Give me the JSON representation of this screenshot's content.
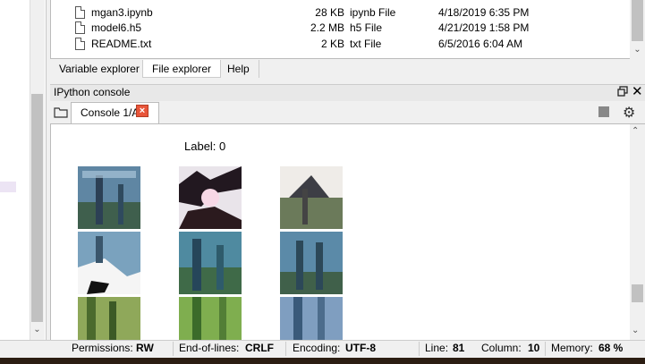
{
  "files": [
    {
      "name": "mgan3.ipynb",
      "size": "28 KB",
      "type": "ipynb File",
      "date": "4/18/2019 6:35 PM"
    },
    {
      "name": "model6.h5",
      "size": "2.2 MB",
      "type": "h5 File",
      "date": "4/21/2019 1:58 PM"
    },
    {
      "name": "README.txt",
      "size": "2 KB",
      "type": "txt File",
      "date": "6/5/2016 6:04 AM"
    }
  ],
  "bottom_tabs": [
    "Variable explorer",
    "File explorer",
    "Help"
  ],
  "console": {
    "pane_title": "IPython console",
    "tab_label": "Console 1/A",
    "tab_close": "×",
    "output_label": "Label: 0"
  },
  "status": {
    "permissions_label": "Permissions:",
    "permissions": "RW",
    "eol_label": "End-of-lines:",
    "eol": "CRLF",
    "encoding_label": "Encoding:",
    "encoding": "UTF-8",
    "line_label": "Line:",
    "line": "81",
    "column_label": "Column:",
    "column": "10",
    "memory_label": "Memory:",
    "memory": "68 %"
  },
  "icons": {
    "close": "close-icon",
    "float": "float-icon",
    "folder": "folder-icon",
    "gear": "gear-icon",
    "stop": "stop-icon"
  },
  "colors": {
    "close_tab": "#e8553a"
  }
}
